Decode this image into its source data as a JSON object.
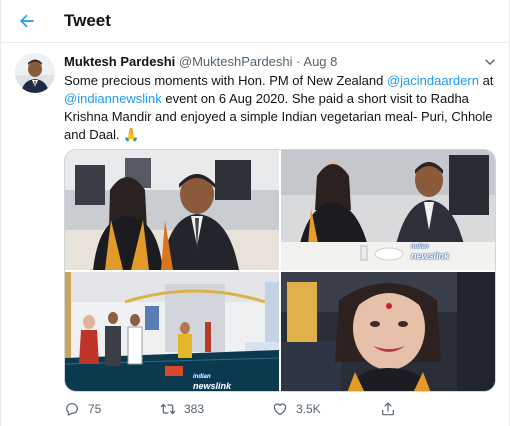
{
  "header": {
    "title": "Tweet",
    "back_icon": "arrow-left-icon",
    "accent": "#1d9bf0"
  },
  "tweet": {
    "author_name": "Muktesh Pardeshi",
    "handle": "@MukteshPardeshi",
    "separator": "·",
    "date": "Aug 8",
    "text": {
      "part1": "Some precious moments with Hon. PM of New Zealand ",
      "mention1": "@jacindaardern",
      "part2": " at ",
      "mention2": "@indiannewslink",
      "part3": "  event on 6 Aug 2020. She paid a short visit to Radha Krishna Mandir and enjoyed a simple Indian vegetarian meal- Puri, Chhole and Daal. ",
      "emoji": "🙏"
    },
    "media": {
      "watermark_top": "indian",
      "watermark_main": "newslink",
      "photos": [
        "photo-1",
        "photo-2",
        "photo-3",
        "photo-4"
      ]
    },
    "stats": {
      "replies": "75",
      "retweets": "383",
      "likes": "3.5K"
    }
  },
  "colors": {
    "text": "#0f1419",
    "muted": "#536471",
    "link": "#1d9bf0",
    "border": "#e6ecf0"
  }
}
